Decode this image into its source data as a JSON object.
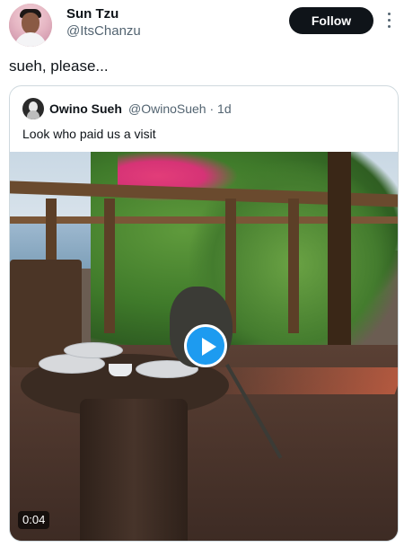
{
  "tweet": {
    "author_name": "Sun Tzu",
    "author_handle": "@ItsChanzu",
    "follow_label": "Follow",
    "text": "sueh, please..."
  },
  "quoted_tweet": {
    "author_name": "Owino Sueh",
    "author_handle": "@OwinoSueh",
    "timestamp": "· 1d",
    "text": "Look who paid us a visit",
    "video": {
      "duration": "0:04",
      "play_icon": "play-icon"
    }
  },
  "colors": {
    "accent": "#1d9bf0",
    "text": "#0f1419",
    "secondary_text": "#536471",
    "border": "#cfd9de",
    "follow_bg": "#0f1419"
  }
}
